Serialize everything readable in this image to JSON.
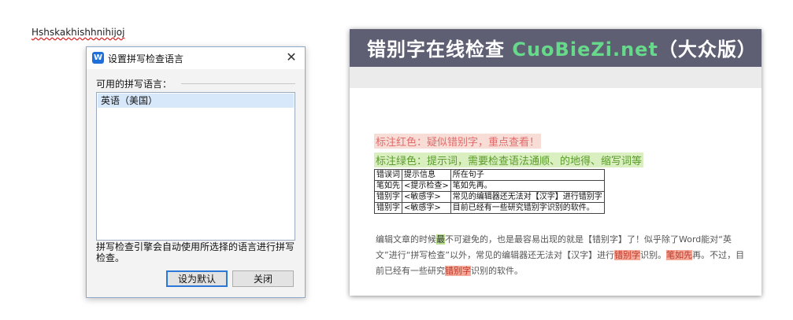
{
  "document": {
    "text": "Hshskakhishhnihijoj"
  },
  "dialog": {
    "title": "设置拼写检查语言",
    "close_glyph": "✕",
    "available_label": "可用的拼写语言：",
    "languages": [
      "英语（美国）"
    ],
    "note": "拼写检查引擎会自动使用所选择的语言进行拼写检查。",
    "set_default_label": "设为默认",
    "close_label": "关闭"
  },
  "website": {
    "title_cn": "错别字在线检查",
    "title_en": "CuoBieZi.net",
    "title_suffix": "（大众版）",
    "legend_red": "标注红色：疑似错别字，重点查看！",
    "legend_green": "标注绿色：提示词，需要检查语法通顺、的地得、缩写词等",
    "table": {
      "headers": [
        "错误词",
        "提示信息",
        "所在句子"
      ],
      "rows": [
        [
          "笔如先",
          "<提示检查>",
          "笔如先再。"
        ],
        [
          "错别字",
          "<敏感字>",
          "常见的编辑器还无法对【汉字】进行错别字"
        ],
        [
          "错别字",
          "<敏感字>",
          "目前已经有一些研究错别字识别的软件。"
        ]
      ]
    },
    "body": {
      "p1": "编辑文章的时候",
      "hl1": "最",
      "p2": "不可避免的，也是最容易出现的就是【错别字】了！似乎除了Word能对“英文”进行“拼写检查”以外，常见的编辑器还无法对【汉字】进行",
      "hl2": "错别字",
      "p3": "识别。",
      "hl3": "笔如先",
      "p4": "再。不过，目前已经有一些研究",
      "hl4": "错别字",
      "p5": "识别的软件。"
    }
  }
}
